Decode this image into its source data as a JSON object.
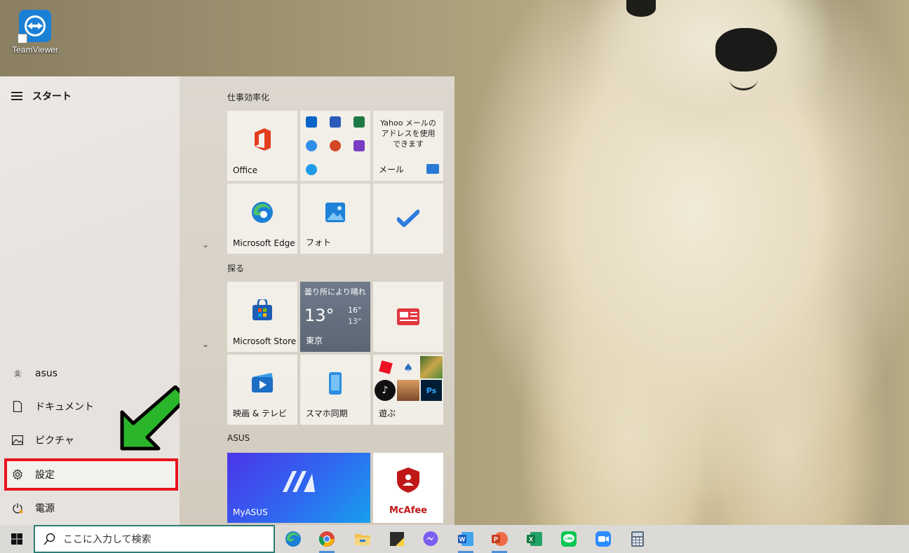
{
  "desktop": {
    "icon_label": "TeamViewer"
  },
  "start_menu": {
    "title": "スタート",
    "user": "asus",
    "rail": [
      {
        "label": "ドキュメント",
        "icon": "document-icon"
      },
      {
        "label": "ピクチャ",
        "icon": "picture-icon"
      },
      {
        "label": "設定",
        "icon": "gear-icon"
      },
      {
        "label": "電源",
        "icon": "power-icon"
      }
    ],
    "groups": {
      "productivity": "仕事効率化",
      "explore": "探る",
      "asus": "ASUS"
    },
    "tiles": {
      "office": "Office",
      "mail_text": "Yahoo メールのアドレスを使用できます",
      "mail": "メール",
      "edge": "Microsoft Edge",
      "photos": "フォト",
      "store": "Microsoft Store",
      "weather_cond": "曇り所により晴れ",
      "weather_temp": "13°",
      "weather_hi": "16°",
      "weather_lo": "13°",
      "weather_city": "東京",
      "movies": "映画 & テレビ",
      "phone": "スマホ同期",
      "play": "遊ぶ",
      "myasus": "MyASUS",
      "mcafee": "McAfee"
    },
    "highlight_color": "#e8141c",
    "arrow_color": "#2bb52b"
  },
  "taskbar": {
    "search_placeholder": "ここに入力して検索",
    "apps": [
      "edge-icon",
      "chrome-icon",
      "file-explorer-icon",
      "sticky-notes-icon",
      "messenger-icon",
      "word-icon",
      "powerpoint-icon",
      "excel-icon",
      "line-icon",
      "zoom-icon",
      "calculator-icon"
    ]
  }
}
